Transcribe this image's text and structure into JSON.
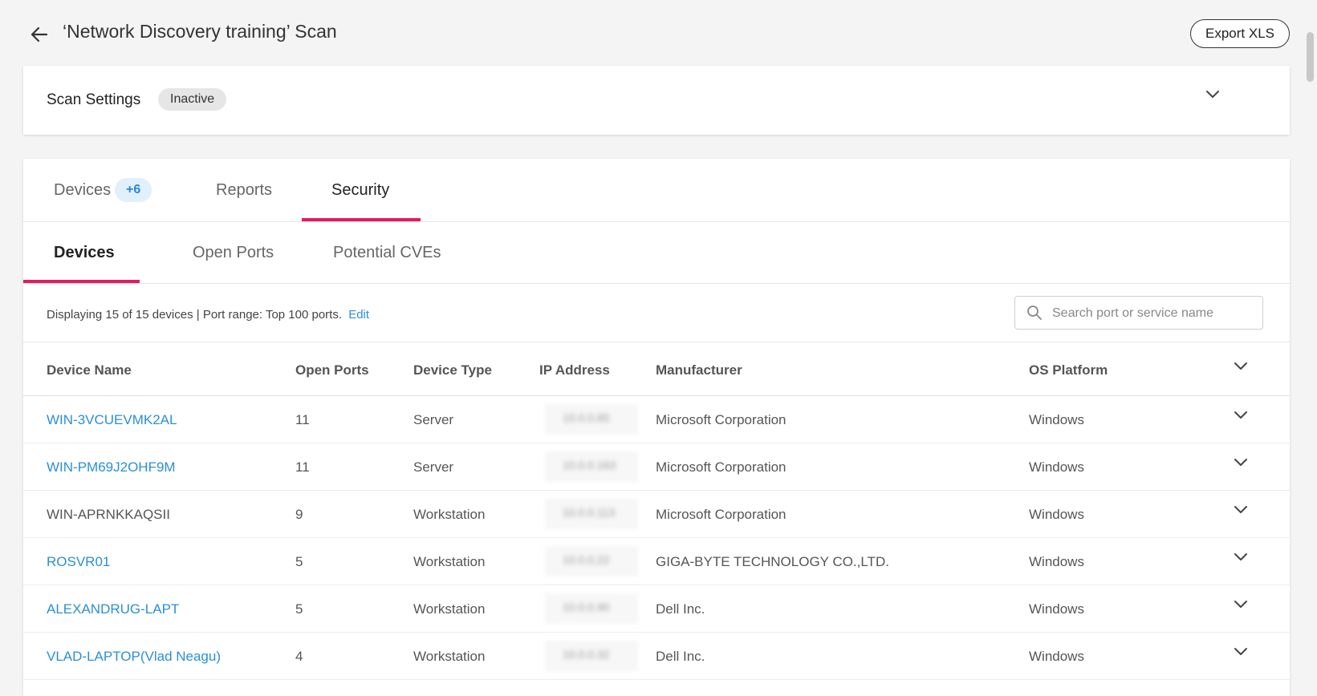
{
  "header": {
    "title": "‘Network Discovery training’ Scan",
    "export_label": "Export XLS"
  },
  "settings": {
    "title": "Scan Settings",
    "status": "Inactive"
  },
  "tabs": [
    {
      "label": "Devices",
      "badge": "+6",
      "active": false
    },
    {
      "label": "Reports",
      "active": false
    },
    {
      "label": "Security",
      "active": true
    }
  ],
  "subtabs": [
    {
      "label": "Devices",
      "active": true
    },
    {
      "label": "Open Ports",
      "active": false
    },
    {
      "label": "Potential CVEs",
      "active": false
    }
  ],
  "info": {
    "text": "Displaying 15 of 15 devices | Port range: Top 100 ports.",
    "edit_label": "Edit"
  },
  "search": {
    "placeholder": "Search port or service name",
    "value": ""
  },
  "table": {
    "columns": [
      "Device Name",
      "Open Ports",
      "Device Type",
      "IP Address",
      "Manufacturer",
      "OS Platform"
    ],
    "rows": [
      {
        "name": "WIN-3VCUEVMK2AL",
        "ports": "11",
        "type": "Server",
        "ip": "10.0.0.85",
        "manufacturer": "Microsoft Corporation",
        "os": "Windows",
        "link": true
      },
      {
        "name": "WIN-PM69J2OHF9M",
        "ports": "11",
        "type": "Server",
        "ip": "10.0.0.163",
        "manufacturer": "Microsoft Corporation",
        "os": "Windows",
        "link": true
      },
      {
        "name": "WIN-APRNKKAQSII",
        "ports": "9",
        "type": "Workstation",
        "ip": "10.0.0.113",
        "manufacturer": "Microsoft Corporation",
        "os": "Windows",
        "link": false
      },
      {
        "name": "ROSVR01",
        "ports": "5",
        "type": "Workstation",
        "ip": "10.0.0.22",
        "manufacturer": "GIGA-BYTE TECHNOLOGY CO.,LTD.",
        "os": "Windows",
        "link": true
      },
      {
        "name": "ALEXANDRUG-LAPT",
        "ports": "5",
        "type": "Workstation",
        "ip": "10.0.0.90",
        "manufacturer": "Dell Inc.",
        "os": "Windows",
        "link": true
      },
      {
        "name": "VLAD-LAPTOP(Vlad Neagu)",
        "ports": "4",
        "type": "Workstation",
        "ip": "10.0.0.32",
        "manufacturer": "Dell Inc.",
        "os": "Windows",
        "link": true
      }
    ]
  },
  "colors": {
    "accent": "#e8195e",
    "link": "#2a8fd6",
    "badge_bg": "#e1f0fb"
  },
  "icons": {
    "back": "arrow-left-icon",
    "chevron": "chevron-down-icon",
    "search": "search-icon"
  }
}
